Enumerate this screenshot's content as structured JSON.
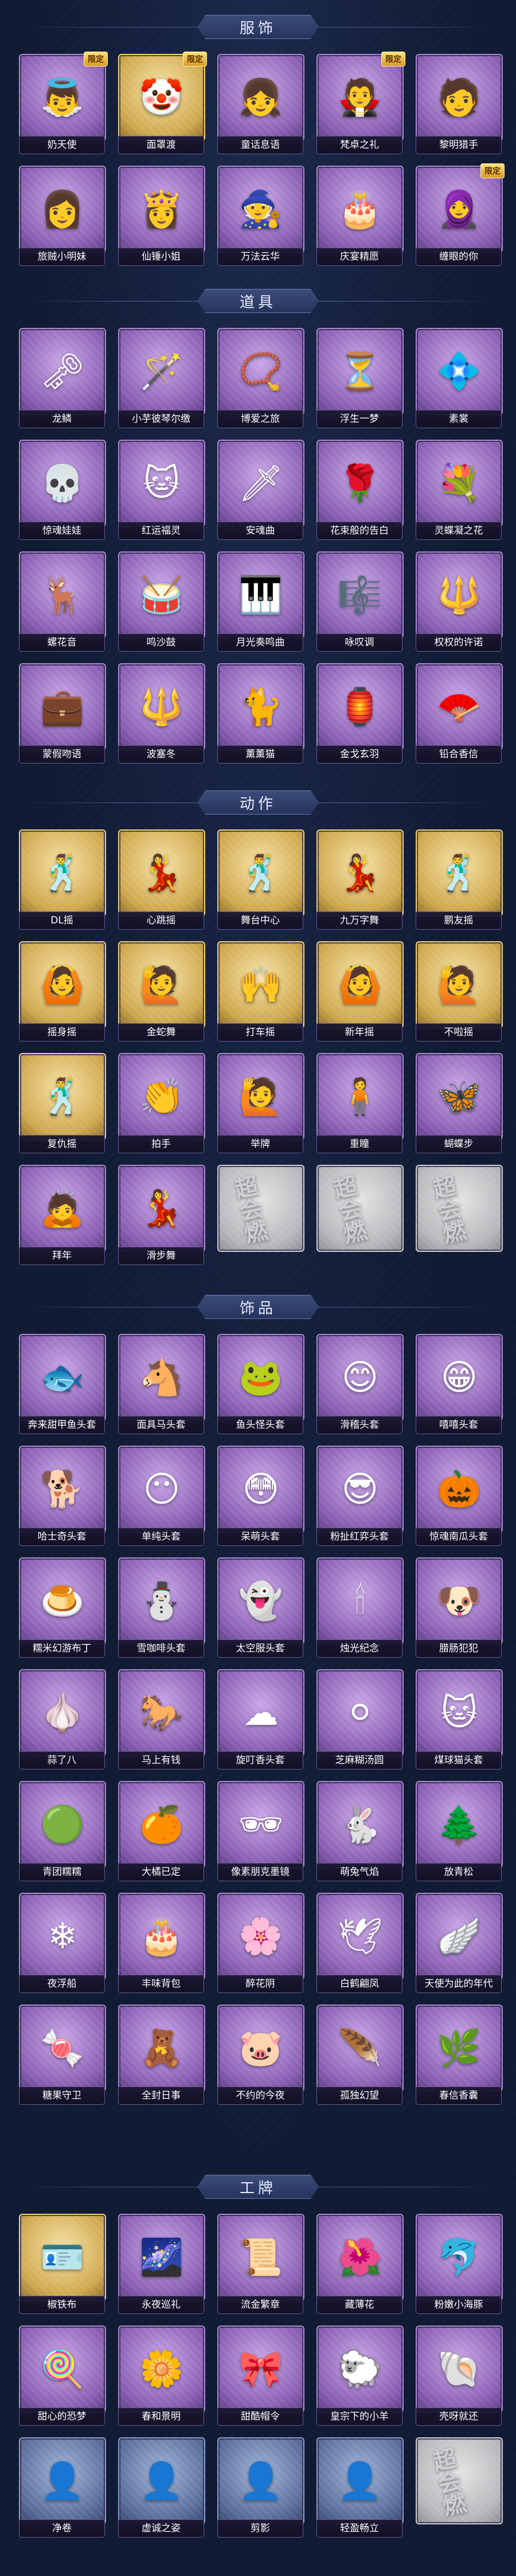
{
  "sections": [
    {
      "title": "服饰",
      "items": [
        {
          "label": "奶天使",
          "icon": "angel-portrait",
          "glyph": "👼",
          "rarity": "purple",
          "tag": "限定"
        },
        {
          "label": "面罩渡",
          "icon": "masked-portrait",
          "glyph": "🤡",
          "rarity": "gold",
          "tag": "限定"
        },
        {
          "label": "童话息语",
          "icon": "fairy-girl-portrait",
          "glyph": "👧",
          "rarity": "purple",
          "tag": ""
        },
        {
          "label": "梵卓之礼",
          "icon": "vampire-portrait",
          "glyph": "🧛",
          "rarity": "purple",
          "tag": "限定"
        },
        {
          "label": "黎明猎手",
          "icon": "hunter-portrait",
          "glyph": "🧑",
          "rarity": "purple",
          "tag": ""
        },
        {
          "label": "旅贼小明妹",
          "icon": "girl-portrait",
          "glyph": "👩",
          "rarity": "purple",
          "tag": ""
        },
        {
          "label": "仙锤小姐",
          "icon": "lady-portrait",
          "glyph": "👸",
          "rarity": "purple",
          "tag": ""
        },
        {
          "label": "万法云华",
          "icon": "mage-portrait",
          "glyph": "🧙",
          "rarity": "purple",
          "tag": ""
        },
        {
          "label": "庆宴精愿",
          "icon": "feast-portrait",
          "glyph": "🎂",
          "rarity": "purple",
          "tag": ""
        },
        {
          "label": "缠眼的你",
          "icon": "eyes-portrait",
          "glyph": "🧕",
          "rarity": "purple",
          "tag": "限定"
        }
      ]
    },
    {
      "title": "道具",
      "items": [
        {
          "label": "龙鳞",
          "icon": "golden-key-icon",
          "glyph": "🗝",
          "rarity": "purple",
          "tag": ""
        },
        {
          "label": "小芋彼琴尔缴",
          "icon": "staff-icon",
          "glyph": "🪄",
          "rarity": "purple",
          "tag": ""
        },
        {
          "label": "博爱之旅",
          "icon": "chain-icon",
          "glyph": "📿",
          "rarity": "purple",
          "tag": ""
        },
        {
          "label": "浮生一梦",
          "icon": "hourglass-icon",
          "glyph": "⏳",
          "rarity": "purple",
          "tag": ""
        },
        {
          "label": "素裳",
          "icon": "necklace-icon",
          "glyph": "💠",
          "rarity": "purple",
          "tag": ""
        },
        {
          "label": "惊魂娃娃",
          "icon": "skull-doll-icon",
          "glyph": "💀",
          "rarity": "purple",
          "tag": ""
        },
        {
          "label": "红运福灵",
          "icon": "fortune-cat-icon",
          "glyph": "🐱",
          "rarity": "purple",
          "tag": ""
        },
        {
          "label": "安魂曲",
          "icon": "blade-icon",
          "glyph": "🗡",
          "rarity": "purple",
          "tag": ""
        },
        {
          "label": "花束般的告白",
          "icon": "rose-icon",
          "glyph": "🌹",
          "rarity": "purple",
          "tag": ""
        },
        {
          "label": "灵蝶凝之花",
          "icon": "flower-icon",
          "glyph": "💐",
          "rarity": "purple",
          "tag": ""
        },
        {
          "label": "螺花音",
          "icon": "antlers-icon",
          "glyph": "🦌",
          "rarity": "purple",
          "tag": ""
        },
        {
          "label": "鸣沙鼓",
          "icon": "drum-icon",
          "glyph": "🥁",
          "rarity": "purple",
          "tag": ""
        },
        {
          "label": "月光奏鸣曲",
          "icon": "piano-icon",
          "glyph": "🎹",
          "rarity": "purple",
          "tag": ""
        },
        {
          "label": "咏叹调",
          "icon": "music-box-icon",
          "glyph": "🎼",
          "rarity": "purple",
          "tag": ""
        },
        {
          "label": "权权的许诺",
          "icon": "scepter-icon",
          "glyph": "🔱",
          "rarity": "purple",
          "tag": ""
        },
        {
          "label": "蒙假吻语",
          "icon": "medkit-icon",
          "glyph": "💼",
          "rarity": "purple",
          "tag": ""
        },
        {
          "label": "波塞冬",
          "icon": "trident-icon",
          "glyph": "🔱",
          "rarity": "purple",
          "tag": ""
        },
        {
          "label": "薰薰猫",
          "icon": "cat-portrait-icon",
          "glyph": "🐈",
          "rarity": "purple",
          "tag": ""
        },
        {
          "label": "金戈玄羽",
          "icon": "lantern-icon",
          "glyph": "🏮",
          "rarity": "purple",
          "tag": ""
        },
        {
          "label": "铅合香信",
          "icon": "fan-icon",
          "glyph": "🪭",
          "rarity": "purple",
          "tag": ""
        }
      ]
    },
    {
      "title": "动作",
      "items": [
        {
          "label": "DL摇",
          "icon": "dance-pose-icon",
          "glyph": "🕺",
          "rarity": "gold",
          "tag": ""
        },
        {
          "label": "心跳摇",
          "icon": "dance-pose-icon",
          "glyph": "💃",
          "rarity": "gold",
          "tag": ""
        },
        {
          "label": "舞台中心",
          "icon": "dance-pose-icon",
          "glyph": "🕺",
          "rarity": "gold",
          "tag": ""
        },
        {
          "label": "九万字舞",
          "icon": "dance-pose-icon",
          "glyph": "💃",
          "rarity": "gold",
          "tag": ""
        },
        {
          "label": "鹏友摇",
          "icon": "dance-pose-icon",
          "glyph": "🕺",
          "rarity": "gold",
          "tag": ""
        },
        {
          "label": "摇身摇",
          "icon": "dance-pose-icon",
          "glyph": "🙆",
          "rarity": "gold",
          "tag": ""
        },
        {
          "label": "金蛇舞",
          "icon": "dance-pose-icon",
          "glyph": "🙋",
          "rarity": "gold",
          "tag": ""
        },
        {
          "label": "打车摇",
          "icon": "dance-pose-icon",
          "glyph": "🙌",
          "rarity": "gold",
          "tag": ""
        },
        {
          "label": "新年摇",
          "icon": "dance-pose-icon",
          "glyph": "🙆",
          "rarity": "gold",
          "tag": ""
        },
        {
          "label": "不啦摇",
          "icon": "dance-pose-icon",
          "glyph": "🙋",
          "rarity": "gold",
          "tag": ""
        },
        {
          "label": "复仇摇",
          "icon": "dance-pose-icon",
          "glyph": "🕺",
          "rarity": "gold",
          "tag": ""
        },
        {
          "label": "拍手",
          "icon": "clap-pose-icon",
          "glyph": "👏",
          "rarity": "purple",
          "tag": ""
        },
        {
          "label": "举牌",
          "icon": "sign-pose-icon",
          "glyph": "🙋",
          "rarity": "purple",
          "tag": ""
        },
        {
          "label": "重瞳",
          "icon": "pose-icon",
          "glyph": "🧍",
          "rarity": "purple",
          "tag": ""
        },
        {
          "label": "蝴蝶步",
          "icon": "butterfly-pose-icon",
          "glyph": "🦋",
          "rarity": "purple",
          "tag": ""
        },
        {
          "label": "拜年",
          "icon": "bow-pose-icon",
          "glyph": "🙇",
          "rarity": "purple",
          "tag": ""
        },
        {
          "label": "滑步舞",
          "icon": "slide-pose-icon",
          "glyph": "💃",
          "rarity": "purple",
          "tag": ""
        },
        {
          "label": "",
          "icon": "locked-placeholder",
          "glyph": "超会燃",
          "rarity": "gray",
          "tag": ""
        },
        {
          "label": "",
          "icon": "locked-placeholder",
          "glyph": "超会燃",
          "rarity": "gray",
          "tag": ""
        },
        {
          "label": "",
          "icon": "locked-placeholder",
          "glyph": "超会燃",
          "rarity": "gray",
          "tag": ""
        }
      ]
    },
    {
      "title": "饰品",
      "items": [
        {
          "label": "奔来甜甲鱼头套",
          "icon": "fish-head-icon",
          "glyph": "🐟",
          "rarity": "purple",
          "tag": ""
        },
        {
          "label": "面具马头套",
          "icon": "horse-head-icon",
          "glyph": "🐴",
          "rarity": "purple",
          "tag": ""
        },
        {
          "label": "鱼头怪头套",
          "icon": "fish-monster-icon",
          "glyph": "🐸",
          "rarity": "purple",
          "tag": ""
        },
        {
          "label": "滑稽头套",
          "icon": "smile-head-icon",
          "glyph": "😊",
          "rarity": "purple",
          "tag": ""
        },
        {
          "label": "嘻嘻头套",
          "icon": "grin-head-icon",
          "glyph": "😁",
          "rarity": "purple",
          "tag": ""
        },
        {
          "label": "哈士奇头套",
          "icon": "dog-head-icon",
          "glyph": "🐕",
          "rarity": "purple",
          "tag": ""
        },
        {
          "label": "单纯头套",
          "icon": "emoji-head-icon",
          "glyph": "😶",
          "rarity": "purple",
          "tag": ""
        },
        {
          "label": "呆萌头套",
          "icon": "stare-head-icon",
          "glyph": "😳",
          "rarity": "purple",
          "tag": ""
        },
        {
          "label": "粉扯红弈头套",
          "icon": "pikachu-head-icon",
          "glyph": "😎",
          "rarity": "purple",
          "tag": ""
        },
        {
          "label": "惊魂南瓜头套",
          "icon": "pumpkin-head-icon",
          "glyph": "🎃",
          "rarity": "purple",
          "tag": ""
        },
        {
          "label": "糯米幻游布丁",
          "icon": "pudding-icon",
          "glyph": "🍮",
          "rarity": "purple",
          "tag": ""
        },
        {
          "label": "雪咖啡头套",
          "icon": "snowman-head-icon",
          "glyph": "⛄",
          "rarity": "purple",
          "tag": ""
        },
        {
          "label": "太空服头套",
          "icon": "space-head-icon",
          "glyph": "👻",
          "rarity": "purple",
          "tag": ""
        },
        {
          "label": "烛光纪念",
          "icon": "candle-icon",
          "glyph": "🕯",
          "rarity": "purple",
          "tag": ""
        },
        {
          "label": "腊肠犯犯",
          "icon": "dachshund-icon",
          "glyph": "🐶",
          "rarity": "purple",
          "tag": ""
        },
        {
          "label": "蒜了八",
          "icon": "garlic-icon",
          "glyph": "🧄",
          "rarity": "purple",
          "tag": ""
        },
        {
          "label": "马上有钱",
          "icon": "red-horse-icon",
          "glyph": "🐎",
          "rarity": "purple",
          "tag": ""
        },
        {
          "label": "旋叮香头套",
          "icon": "cloud-head-icon",
          "glyph": "☁",
          "rarity": "purple",
          "tag": ""
        },
        {
          "label": "芝麻糊汤圆",
          "icon": "dumpling-icon",
          "glyph": "⚪",
          "rarity": "purple",
          "tag": ""
        },
        {
          "label": "煤球猫头套",
          "icon": "cat-head-icon",
          "glyph": "🐱",
          "rarity": "purple",
          "tag": ""
        },
        {
          "label": "青团糯糯",
          "icon": "rice-ball-icon",
          "glyph": "🟢",
          "rarity": "purple",
          "tag": ""
        },
        {
          "label": "大橘已定",
          "icon": "orange-icon",
          "glyph": "🍊",
          "rarity": "purple",
          "tag": ""
        },
        {
          "label": "像素朋克墨镜",
          "icon": "pixel-glasses-icon",
          "glyph": "🕶",
          "rarity": "purple",
          "tag": ""
        },
        {
          "label": "萌兔气焰",
          "icon": "rabbit-icon",
          "glyph": "🐇",
          "rarity": "purple",
          "tag": ""
        },
        {
          "label": "放青松",
          "icon": "pine-icon",
          "glyph": "🌲",
          "rarity": "purple",
          "tag": ""
        },
        {
          "label": "夜浮船",
          "icon": "crystal-icon",
          "glyph": "❄",
          "rarity": "purple",
          "tag": ""
        },
        {
          "label": "丰味背包",
          "icon": "cake-backpack-icon",
          "glyph": "🎂",
          "rarity": "purple",
          "tag": ""
        },
        {
          "label": "醉花阴",
          "icon": "flower-crown-icon",
          "glyph": "🌸",
          "rarity": "purple",
          "tag": ""
        },
        {
          "label": "白鹤翩凤",
          "icon": "crane-icon",
          "glyph": "🕊",
          "rarity": "purple",
          "tag": ""
        },
        {
          "label": "天使为此的年代",
          "icon": "angel-wing-icon",
          "glyph": "🪽",
          "rarity": "purple",
          "tag": ""
        },
        {
          "label": "糖果守卫",
          "icon": "candy-guard-icon",
          "glyph": "🍬",
          "rarity": "purple",
          "tag": ""
        },
        {
          "label": "全封日事",
          "icon": "doll-icon",
          "glyph": "🧸",
          "rarity": "purple",
          "tag": ""
        },
        {
          "label": "不约的今夜",
          "icon": "pig-charm-icon",
          "glyph": "🐷",
          "rarity": "purple",
          "tag": ""
        },
        {
          "label": "孤独幻望",
          "icon": "feather-icon",
          "glyph": "🪶",
          "rarity": "purple",
          "tag": ""
        },
        {
          "label": "春信香囊",
          "icon": "sachet-icon",
          "glyph": "🌿",
          "rarity": "purple",
          "tag": ""
        }
      ]
    },
    {
      "title": "工牌",
      "items": [
        {
          "label": "椒铁布",
          "icon": "badge-icon",
          "glyph": "🪪",
          "rarity": "gold",
          "tag": ""
        },
        {
          "label": "永夜巡礼",
          "icon": "badge-icon",
          "glyph": "🌌",
          "rarity": "purple",
          "tag": ""
        },
        {
          "label": "流金繁章",
          "icon": "badge-icon",
          "glyph": "📜",
          "rarity": "purple",
          "tag": ""
        },
        {
          "label": "藏薄花",
          "icon": "badge-icon",
          "glyph": "🌺",
          "rarity": "purple",
          "tag": ""
        },
        {
          "label": "粉嫩小海豚",
          "icon": "badge-icon",
          "glyph": "🐬",
          "rarity": "purple",
          "tag": ""
        },
        {
          "label": "甜心的恐梦",
          "icon": "badge-icon",
          "glyph": "🍭",
          "rarity": "purple",
          "tag": ""
        },
        {
          "label": "春和景明",
          "icon": "badge-icon",
          "glyph": "🌼",
          "rarity": "purple",
          "tag": ""
        },
        {
          "label": "甜酷帽令",
          "icon": "badge-icon",
          "glyph": "🎀",
          "rarity": "purple",
          "tag": ""
        },
        {
          "label": "皇宗下的小羊",
          "icon": "badge-icon",
          "glyph": "🐑",
          "rarity": "purple",
          "tag": ""
        },
        {
          "label": "壳呀就还",
          "icon": "badge-icon",
          "glyph": "🐚",
          "rarity": "purple",
          "tag": ""
        },
        {
          "label": "净卷",
          "icon": "silhouette-badge-icon",
          "glyph": "👤",
          "rarity": "blue",
          "tag": ""
        },
        {
          "label": "虚诚之姿",
          "icon": "silhouette-badge-icon",
          "glyph": "👤",
          "rarity": "blue",
          "tag": ""
        },
        {
          "label": "剪影",
          "icon": "silhouette-badge-icon",
          "glyph": "👤",
          "rarity": "blue",
          "tag": ""
        },
        {
          "label": "轻盈畅立",
          "icon": "silhouette-badge-icon",
          "glyph": "👤",
          "rarity": "blue",
          "tag": ""
        },
        {
          "label": "",
          "icon": "locked-placeholder",
          "glyph": "超会燃",
          "rarity": "gray",
          "tag": ""
        }
      ]
    }
  ]
}
